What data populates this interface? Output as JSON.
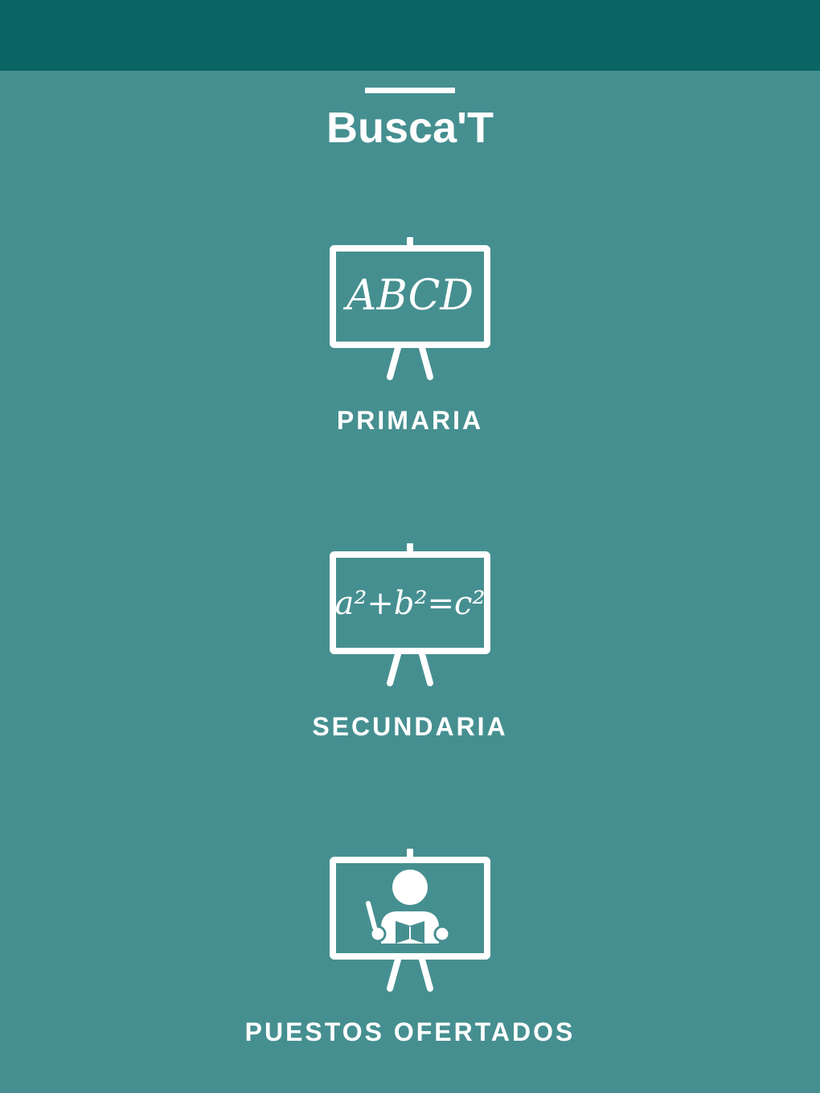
{
  "app": {
    "title": "Busca'T"
  },
  "menu": [
    {
      "id": "primaria",
      "label": "PRIMARIA",
      "board_text": "ABCD",
      "icon": "chalkboard-abc-icon"
    },
    {
      "id": "secundaria",
      "label": "SECUNDARIA",
      "board_text": "a²+b²=c²",
      "icon": "chalkboard-formula-icon"
    },
    {
      "id": "puestos",
      "label": "PUESTOS OFERTADOS",
      "icon": "chalkboard-teacher-icon"
    }
  ],
  "colors": {
    "status_bar": "#096463",
    "background": "#468f90",
    "foreground": "#ffffff"
  }
}
